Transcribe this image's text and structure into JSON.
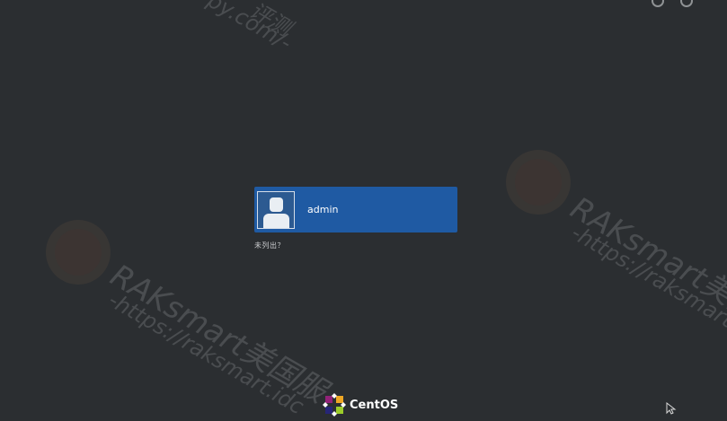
{
  "login": {
    "users": [
      {
        "name": "admin"
      }
    ],
    "not_listed_label": "未列出？"
  },
  "branding": {
    "name": "CentOS"
  },
  "watermarks": [
    {
      "brand": "RAKsmart美国服",
      "url": "-https://raksmart.idc"
    },
    {
      "brand": "RAKsmart美国",
      "url": "-https://raksmart."
    },
    {
      "brand": "评测",
      "url": "py.com/-"
    }
  ],
  "colors": {
    "background": "#2b2e31",
    "user_highlight": "#1f5aa3",
    "text": "#ffffff"
  },
  "icons": [
    "user-avatar-icon",
    "centos-logo-icon",
    "mouse-cursor-icon"
  ]
}
